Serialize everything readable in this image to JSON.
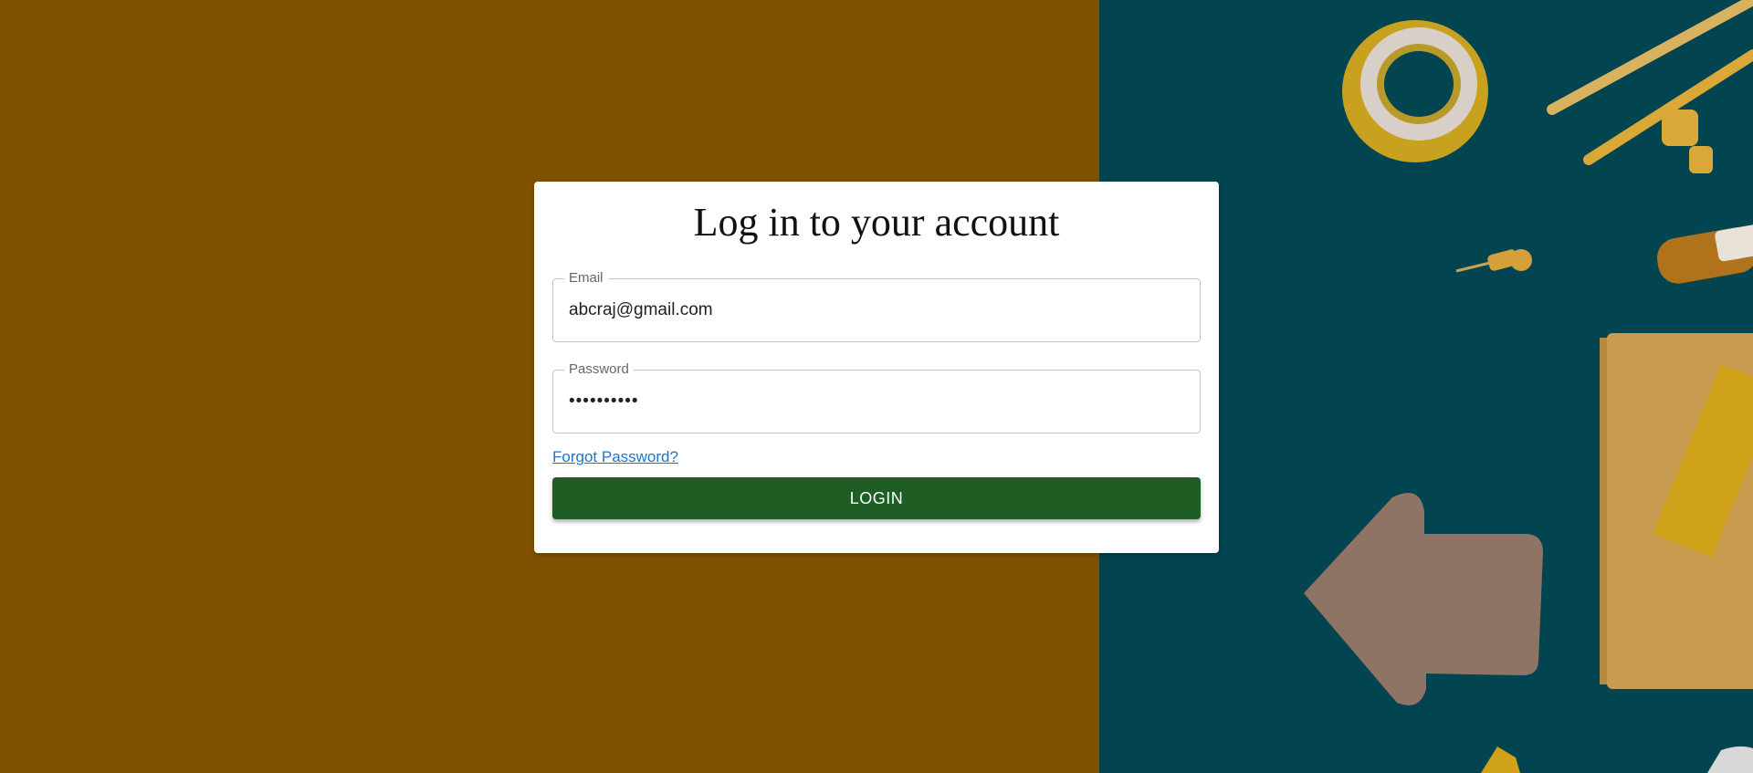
{
  "colors": {
    "background_left": "#7f5200",
    "background_right": "#024450",
    "card": "#ffffff",
    "login_button": "#1e5e24",
    "link": "#1976d2"
  },
  "login": {
    "title": "Log in to your account",
    "email": {
      "label": "Email",
      "value": "abcraj@gmail.com"
    },
    "password": {
      "label": "Password",
      "value": "••••••••••"
    },
    "forgot_password": "Forgot Password?",
    "login_button": "LOGIN"
  },
  "background": {
    "decorations": [
      "tape-roll",
      "compass",
      "push-pin",
      "pen",
      "arrow-sticky-note",
      "notebook",
      "ruler"
    ]
  }
}
